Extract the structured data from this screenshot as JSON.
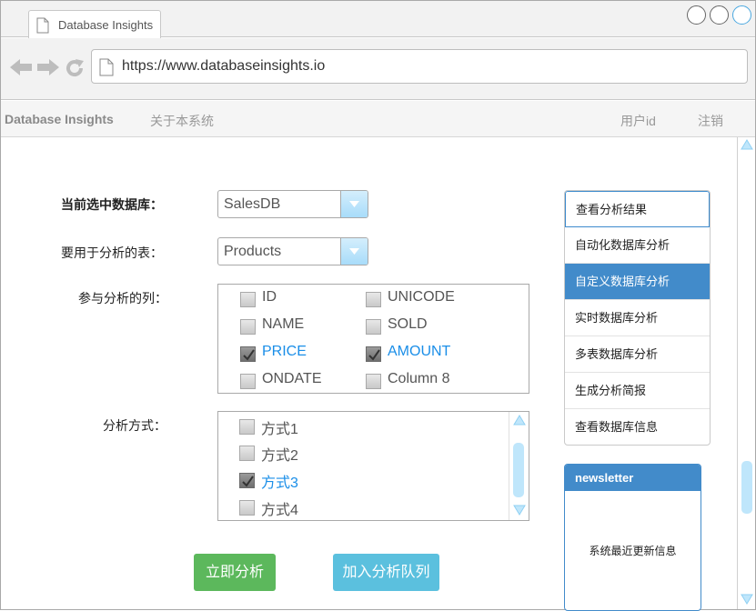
{
  "browser": {
    "tab_title": "Database Insights",
    "url": "https://www.databaseinsights.io"
  },
  "header": {
    "brand": "Database Insights",
    "about": "关于本系统",
    "user": "用户id",
    "logout": "注销"
  },
  "form": {
    "db_label": "当前选中数据库：",
    "db_value": "SalesDB",
    "table_label": "要用于分析的表：",
    "table_value": "Products",
    "columns_label": "参与分析的列：",
    "method_label": "分析方式：",
    "columns": [
      {
        "label": "ID",
        "checked": false
      },
      {
        "label": "UNICODE",
        "checked": false
      },
      {
        "label": "NAME",
        "checked": false
      },
      {
        "label": "SOLD",
        "checked": false
      },
      {
        "label": "PRICE",
        "checked": true
      },
      {
        "label": "AMOUNT",
        "checked": true
      },
      {
        "label": "ONDATE",
        "checked": false
      },
      {
        "label": "Column 8",
        "checked": false
      }
    ],
    "methods": [
      {
        "label": "方式1",
        "checked": false
      },
      {
        "label": "方式2",
        "checked": false
      },
      {
        "label": "方式3",
        "checked": true
      },
      {
        "label": "方式4",
        "checked": false
      }
    ]
  },
  "actions": {
    "analyze": "立即分析",
    "queue": "加入分析队列"
  },
  "menu": {
    "items": [
      "查看分析结果",
      "自动化数据库分析",
      "自定义数据库分析",
      "实时数据库分析",
      "多表数据库分析",
      "生成分析简报",
      "查看数据库信息"
    ],
    "active_index": 2
  },
  "newsletter": {
    "title": "newsletter",
    "body": "系统最近更新信息"
  },
  "colors": {
    "accent": "#428bca",
    "checked_text": "#1a8ee8",
    "success": "#5cb85c",
    "info": "#5bc0de"
  }
}
